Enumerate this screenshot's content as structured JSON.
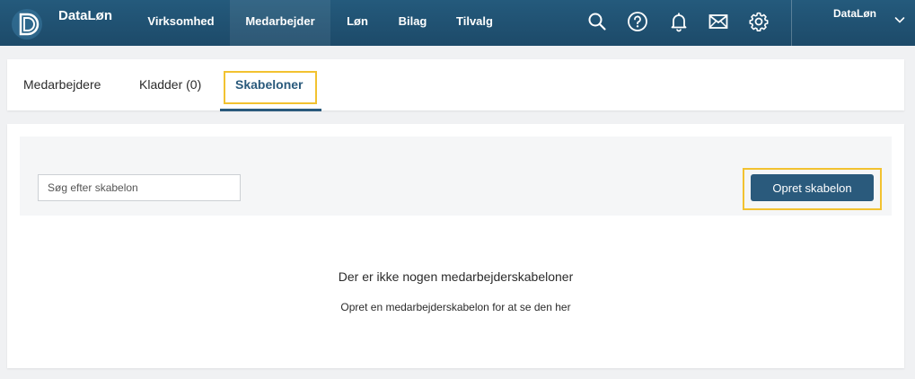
{
  "app": {
    "brand": "DataLøn",
    "logo_letter": "D"
  },
  "nav": {
    "items": [
      {
        "label": "Virksomhed",
        "active": false
      },
      {
        "label": "Medarbejder",
        "active": true
      },
      {
        "label": "Løn",
        "active": false
      },
      {
        "label": "Bilag",
        "active": false
      },
      {
        "label": "Tilvalg",
        "active": false
      }
    ]
  },
  "tools": {
    "icons": [
      "search-icon",
      "help-icon",
      "bell-icon",
      "mail-icon",
      "gear-icon"
    ]
  },
  "user": {
    "name": "DataLøn"
  },
  "tabs": {
    "items": [
      {
        "label": "Medarbejdere",
        "active": false
      },
      {
        "label": "Kladder (0)",
        "active": false
      },
      {
        "label": "Skabeloner",
        "active": true
      }
    ]
  },
  "content": {
    "search_placeholder": "Søg efter skabelon",
    "create_button": "Opret skabelon",
    "empty_title": "Der er ikke nogen medarbejderskabeloner",
    "empty_subtitle": "Opret en medarbejderskabelon for at se den her"
  },
  "colors": {
    "topbar": "#1f4e6e",
    "accent": "#2a5a7c",
    "highlight": "#f2c230"
  }
}
